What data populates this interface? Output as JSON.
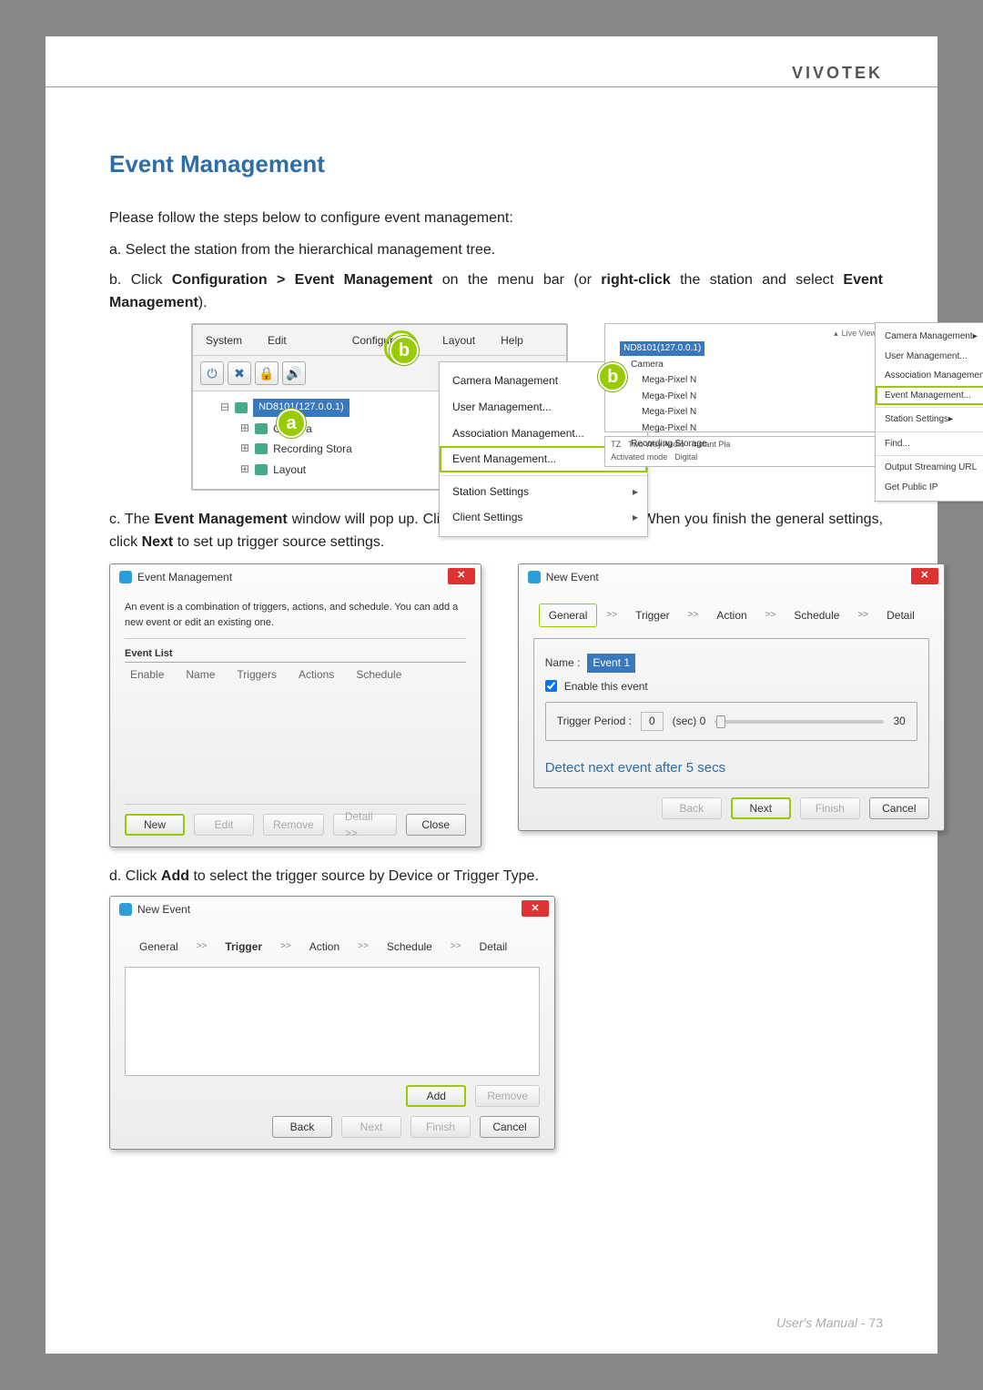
{
  "brand": "VIVOTEK",
  "title": "Event Management",
  "intro": "Please follow the steps below to configure event management:",
  "steps": {
    "a": "a. Select the station from the hierarchical management tree.",
    "b_pre": "b. Click ",
    "b_bold1": "Configuration > Event Management",
    "b_mid": " on the menu bar (or ",
    "b_bold2": "right-click",
    "b_mid2": " the station and select ",
    "b_bold3": "Event Management",
    "b_post": ").",
    "c_pre": "c. The ",
    "c_bold1": "Event Management",
    "c_mid": " window will pop up. Click ",
    "c_bold2": "New",
    "c_mid2": " to set up a new event. When you finish the general settings, click ",
    "c_bold3": "Next",
    "c_post": " to set up trigger source settings.",
    "d_pre": "d. Click ",
    "d_bold": "Add",
    "d_post": " to select the trigger source by Device or Trigger Type."
  },
  "menubar": {
    "system": "System",
    "edit": "Edit",
    "configuration": "Configuration",
    "layout": "Layout",
    "help": "Help"
  },
  "dropdown": {
    "cameraMgmt": "Camera Management",
    "userMgmt": "User Management...",
    "assocMgmt": "Association Management...",
    "eventMgmt": "Event Management...",
    "stationSettings": "Station Settings",
    "clientSettings": "Client Settings"
  },
  "tree": {
    "station": "ND8101(127.0.0.1)",
    "camera": "Camera",
    "recording": "Recording Stora",
    "layoutNode": "Layout"
  },
  "ctx": {
    "station": "ND8101(127.0.0.1)",
    "camera": "Camera",
    "mp": "Mega-Pixel N",
    "recStorage": "Recording Storage",
    "find": "Find...",
    "streamUrl": "Output Streaming URL",
    "publicIp": "Get Public IP",
    "twoWay": "Two Way Audio",
    "instant": "Instant Pla",
    "mode": "Activated mode",
    "digital": "Digital",
    "liveView": "Live View"
  },
  "evtDlg": {
    "title": "Event Management",
    "desc": "An event is a combination of triggers, actions, and schedule. You can add a new event or edit an existing one.",
    "listLabel": "Event List",
    "cols": {
      "enable": "Enable",
      "name": "Name",
      "triggers": "Triggers",
      "actions": "Actions",
      "schedule": "Schedule"
    },
    "btns": {
      "new": "New",
      "edit": "Edit",
      "remove": "Remove",
      "detail": "Detail >>",
      "close": "Close"
    }
  },
  "newEvt": {
    "title": "New Event",
    "tabs": {
      "general": "General",
      "trigger": "Trigger",
      "action": "Action",
      "schedule": "Schedule",
      "detail": "Detail"
    },
    "sep": ">>",
    "nameLabel": "Name  :",
    "nameVal": "Event 1",
    "enableChk": "Enable this event",
    "tp": "Trigger Period  :",
    "tpVal": "0",
    "tpUnit": "(sec)  0",
    "tpMax": "30",
    "hint": "Detect next event after 5 secs",
    "btns": {
      "back": "Back",
      "next": "Next",
      "finish": "Finish",
      "cancel": "Cancel",
      "add": "Add",
      "remove": "Remove"
    }
  },
  "footer": {
    "label": "User's Manual - ",
    "page": "73"
  }
}
